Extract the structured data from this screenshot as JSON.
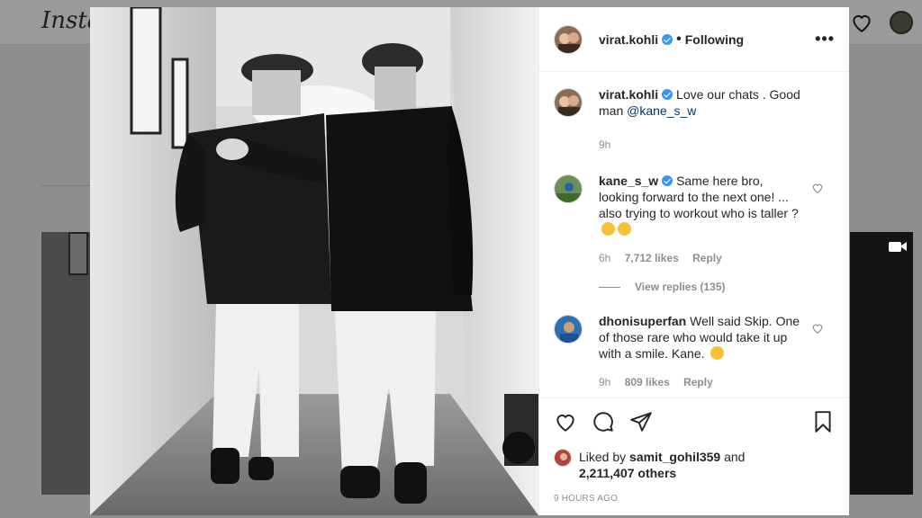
{
  "background": {
    "logo_text": "Insta",
    "icons": [
      "heart-icon",
      "avatar",
      "camera-icon"
    ]
  },
  "post": {
    "author": "virat.kohli",
    "follow_status": "Following",
    "separator": "•",
    "more": "•••",
    "caption": {
      "user": "virat.kohli",
      "text": "Love our chats . Good man ",
      "mention": "@kane_s_w",
      "time": "9h"
    },
    "comments": [
      {
        "user": "kane_s_w",
        "verified": true,
        "text": "Same here bro, looking forward to the next one! ... also trying to workout who is taller ? ",
        "time": "6h",
        "likes": "7,712 likes",
        "reply": "Reply",
        "view_replies": "View replies (135)"
      },
      {
        "user": "dhonisuperfan",
        "verified": false,
        "text": "Well said Skip. One of those rare who would take it up with a smile. Kane. ",
        "time": "9h",
        "likes": "809 likes",
        "reply": "Reply"
      }
    ],
    "liked_by_prefix": "Liked by ",
    "liked_by_user": "samit_gohil359",
    "liked_by_and": " and",
    "liked_by_others": "2,211,407 others",
    "timestamp": "9 HOURS AGO"
  },
  "colors": {
    "verified_badge": "#3897f0",
    "mention": "#00376b",
    "meta_gray": "#8e8e8e"
  }
}
